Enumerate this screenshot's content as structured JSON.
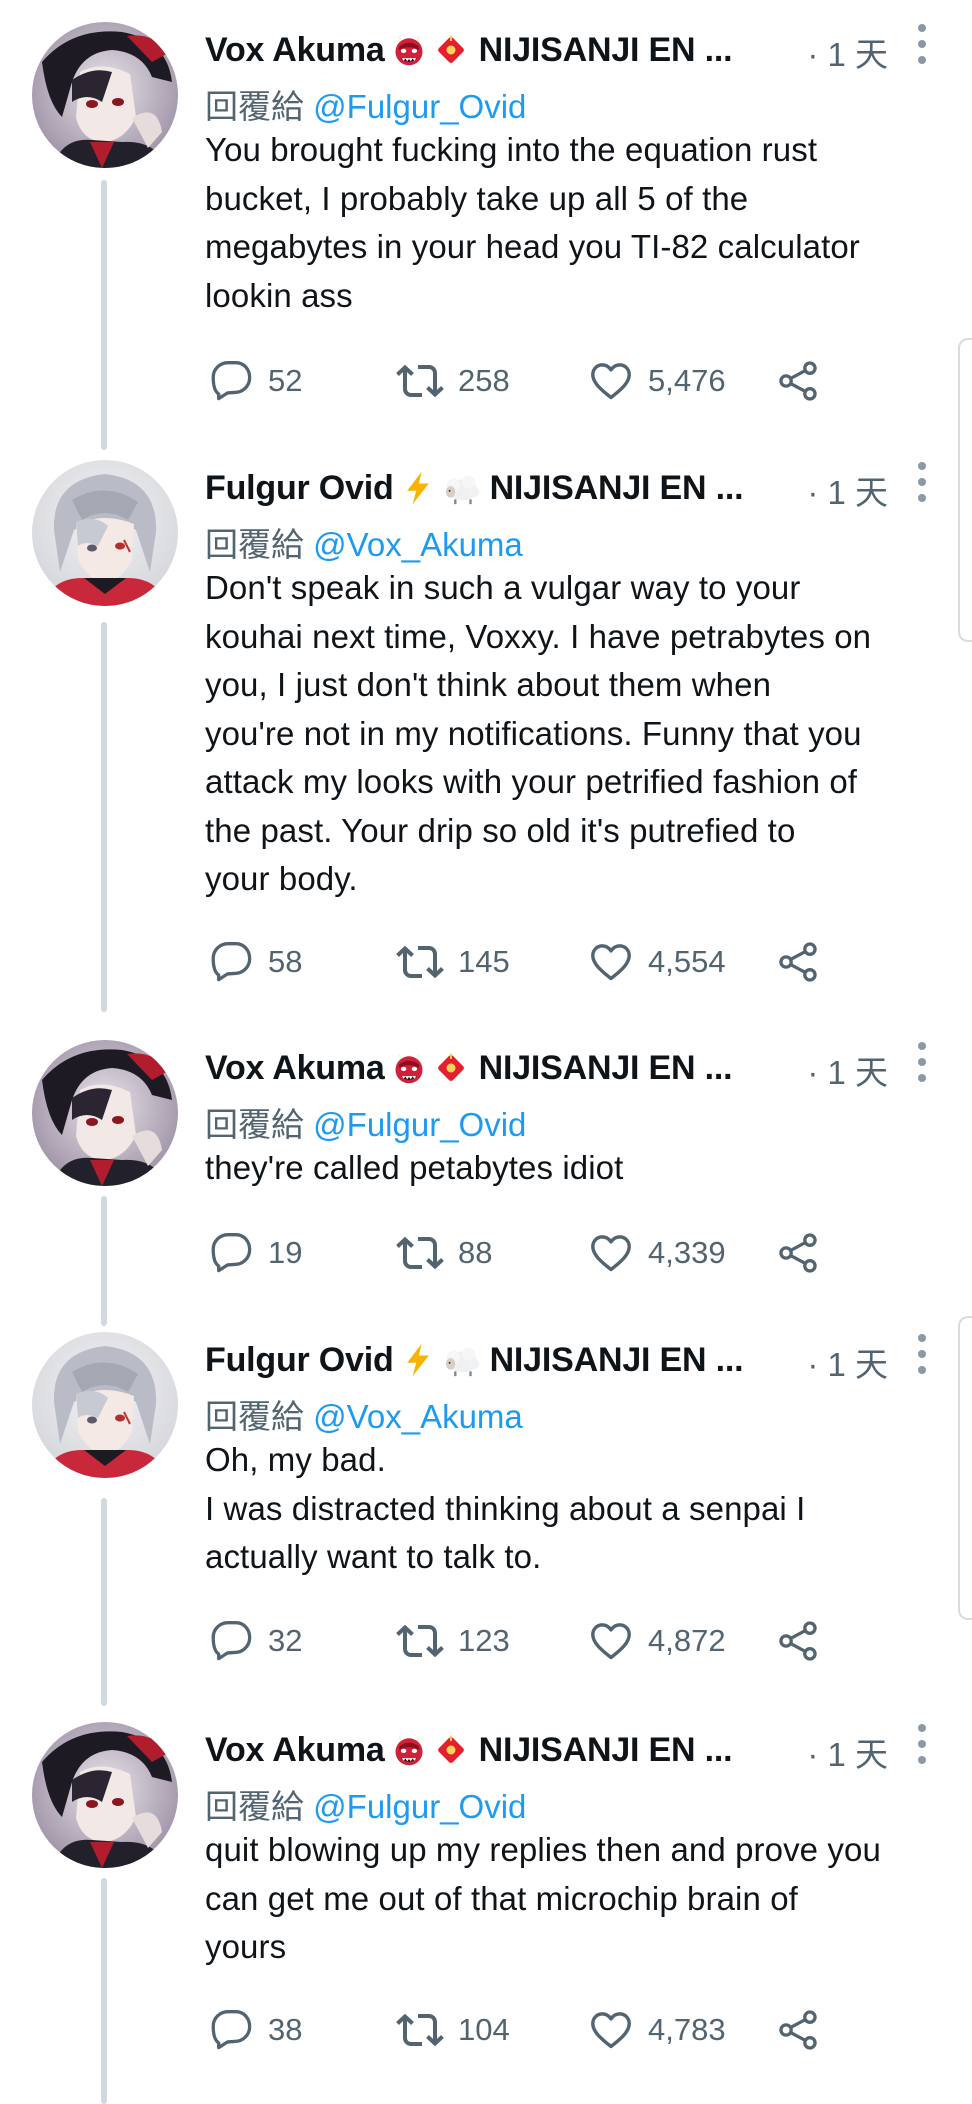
{
  "tweets": [
    {
      "author": "Vox Akuma",
      "author_org": "NIJISANJI EN ...",
      "emojis": [
        "ogre-emoji",
        "omamori-emoji"
      ],
      "time": "· 1 天",
      "reply_prefix": "回覆給",
      "reply_handle": "@Fulgur_Ovid",
      "text": "You brought fucking into the equation rust\nbucket, I probably take up all 5 of the\nmegabytes in your head you TI-82 calculator\nlookin ass",
      "replies": "52",
      "retweets": "258",
      "likes": "5,476"
    },
    {
      "author": "Fulgur Ovid",
      "author_org": "NIJISANJI EN ...",
      "emojis": [
        "lightning-emoji",
        "sheep-emoji"
      ],
      "time": "· 1 天",
      "reply_prefix": "回覆給",
      "reply_handle": "@Vox_Akuma",
      "text": "Don't speak in such a vulgar way to your\nkouhai next time, Voxxy. I have petrabytes on\nyou, I just don't think about them when\nyou're not in my notifications. Funny that you\nattack my looks with your petrified fashion of\nthe past. Your drip so old it's putrefied to\nyour body.",
      "replies": "58",
      "retweets": "145",
      "likes": "4,554"
    },
    {
      "author": "Vox Akuma",
      "author_org": "NIJISANJI EN ...",
      "emojis": [
        "ogre-emoji",
        "omamori-emoji"
      ],
      "time": "· 1 天",
      "reply_prefix": "回覆給",
      "reply_handle": "@Fulgur_Ovid",
      "text": "they're called petabytes idiot",
      "replies": "19",
      "retweets": "88",
      "likes": "4,339"
    },
    {
      "author": "Fulgur Ovid",
      "author_org": "NIJISANJI EN ...",
      "emojis": [
        "lightning-emoji",
        "sheep-emoji"
      ],
      "time": "· 1 天",
      "reply_prefix": "回覆給",
      "reply_handle": "@Vox_Akuma",
      "text": "Oh, my bad.\nI was distracted thinking about a senpai I\nactually want to talk to.",
      "replies": "32",
      "retweets": "123",
      "likes": "4,872"
    },
    {
      "author": "Vox Akuma",
      "author_org": "NIJISANJI EN ...",
      "emojis": [
        "ogre-emoji",
        "omamori-emoji"
      ],
      "time": "· 1 天",
      "reply_prefix": "回覆給",
      "reply_handle": "@Fulgur_Ovid",
      "text": "quit blowing up my replies then and prove you\ncan get me out of that microchip brain of\nyours",
      "replies": "38",
      "retweets": "104",
      "likes": "4,783"
    }
  ],
  "colors": {
    "text": "#0f1419",
    "secondary": "#536471",
    "link": "#1d9bf0",
    "thread_line": "#cfd9de"
  }
}
